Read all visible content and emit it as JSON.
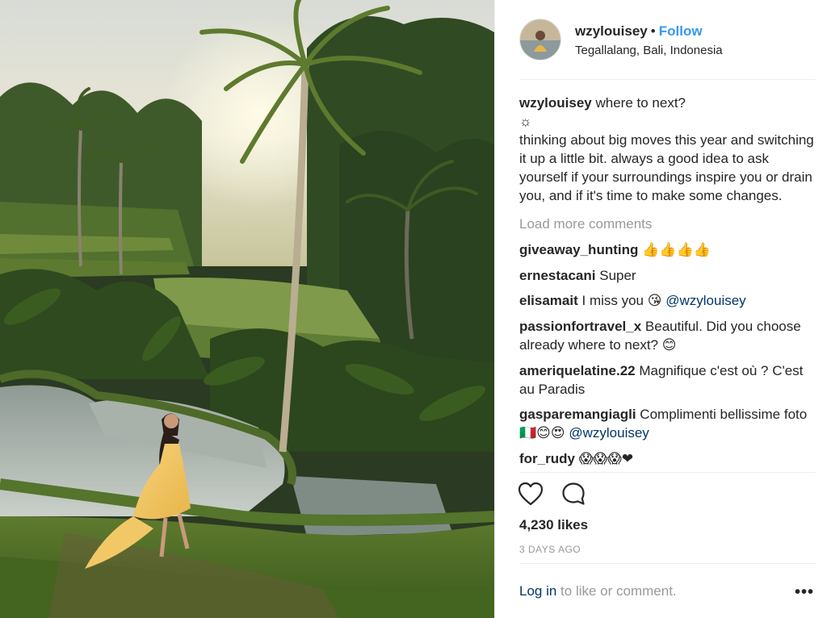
{
  "post": {
    "username": "wzylouisey",
    "separator": "•",
    "follow_label": "Follow",
    "location": "Tegallalang, Bali, Indonesia"
  },
  "caption": {
    "username": "wzylouisey",
    "line1": "where to next?",
    "sun": "☼",
    "body": "thinking about big moves this year and switching it up a little bit. always a good idea to ask yourself if your surroundings inspire you or drain you, and if it's time to make some changes."
  },
  "load_more_label": "Load more comments",
  "comments": [
    {
      "user": "giveaway_hunting",
      "text": "",
      "emoji": "👍👍👍👍",
      "mention": ""
    },
    {
      "user": "ernestacani",
      "text": "Super",
      "emoji": "",
      "mention": ""
    },
    {
      "user": "elisamait",
      "text": "I miss you",
      "emoji": "😘",
      "mention": "@wzylouisey"
    },
    {
      "user": "passionfortravel_x",
      "text": "Beautiful. Did you choose already where to next?",
      "emoji": "😊",
      "mention": ""
    },
    {
      "user": "ameriquelatine.22",
      "text": "Magnifique c'est où ? C'est au Paradis",
      "emoji": "",
      "mention": ""
    },
    {
      "user": "gasparemangiagli",
      "text": "Complimenti bellissime foto",
      "emoji": "🇮🇹😊😍",
      "mention": "@wzylouisey"
    },
    {
      "user": "for_rudy",
      "text": "",
      "emoji": "😱😱😱❤",
      "mention": ""
    }
  ],
  "actions": {
    "like_icon": "heart-icon",
    "comment_icon": "comment-bubble-icon"
  },
  "likes_label": "4,230 likes",
  "time_ago": "3 DAYS AGO",
  "footer": {
    "login_label": "Log in",
    "rest_label": " to like or comment.",
    "more_label": "•••"
  },
  "colors": {
    "link_blue": "#3897f0",
    "mention_blue": "#003569",
    "muted": "#999999",
    "text": "#262626"
  }
}
